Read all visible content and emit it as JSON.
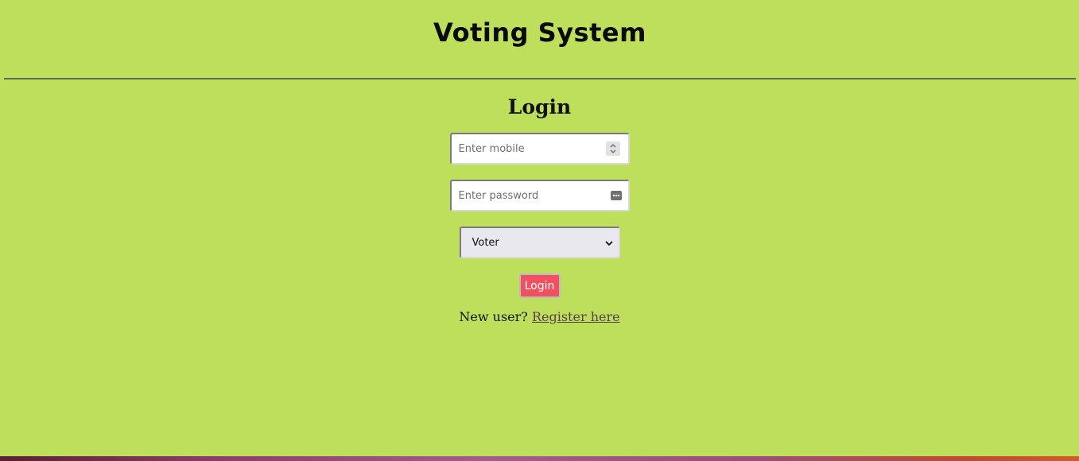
{
  "header": {
    "title": "Voting System"
  },
  "login": {
    "heading": "Login",
    "mobile": {
      "placeholder": "Enter mobile",
      "value": ""
    },
    "password": {
      "placeholder": "Enter password",
      "value": ""
    },
    "role": {
      "selected": "Voter"
    },
    "submit_label": "Login",
    "register_prompt": "New user?",
    "register_link": "Register here"
  },
  "icons": {
    "spinner": "number-spinner-icon",
    "password_key": "password-manager-icon",
    "select_arrow": "chevron-down-icon"
  },
  "colors": {
    "background": "#bddf5c",
    "button": "#f0505f",
    "link": "#5a3f4e"
  }
}
